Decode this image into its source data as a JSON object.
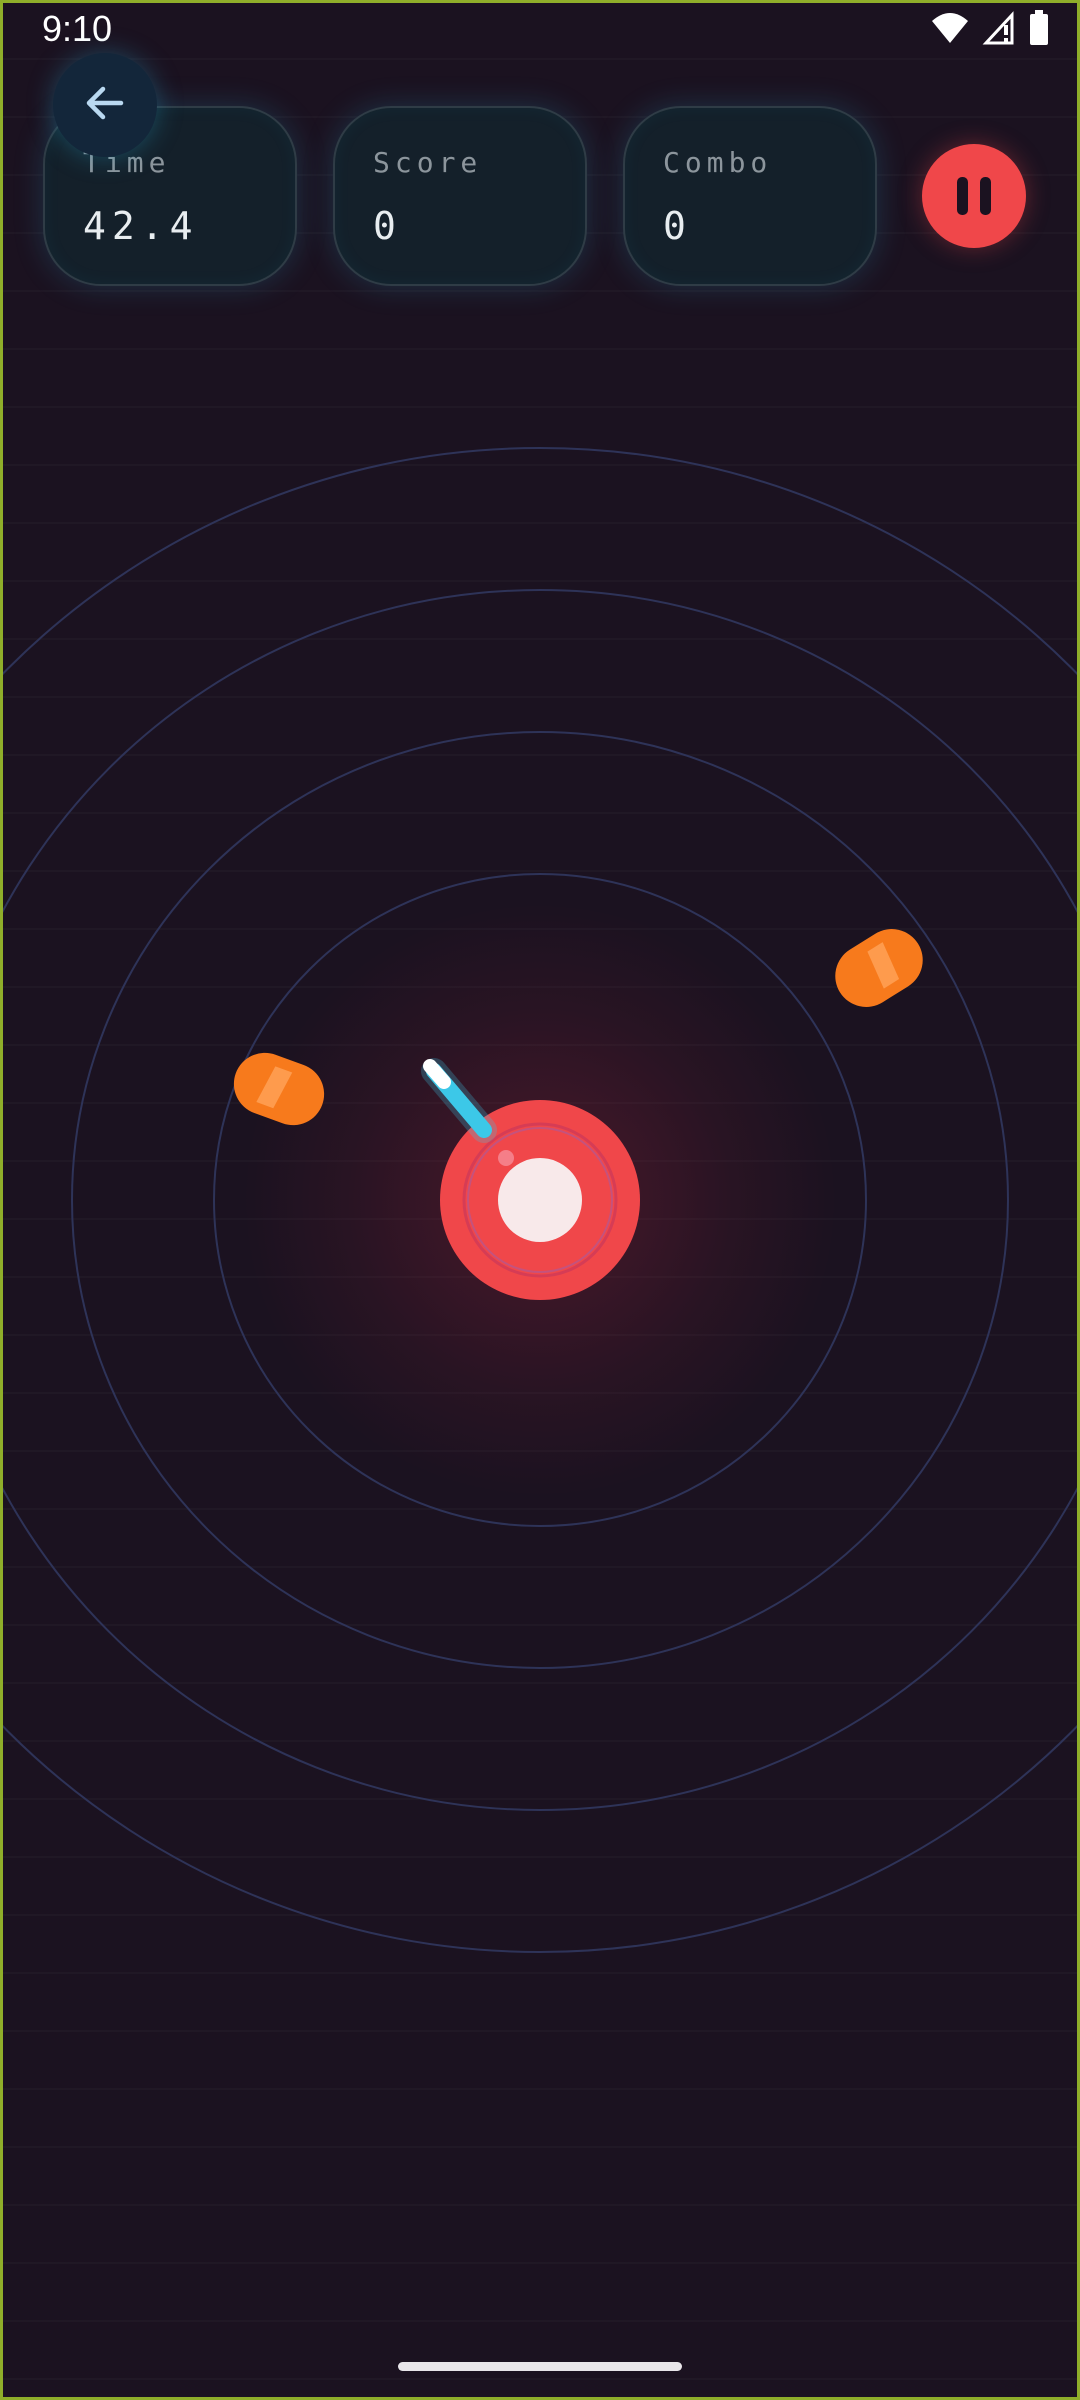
{
  "status_bar": {
    "time": "9:10",
    "icons": [
      "wifi-icon",
      "cell-signal-icon",
      "battery-icon"
    ]
  },
  "hud": {
    "time_label": "Time",
    "time_value": "42.4",
    "score_label": "Score",
    "score_value": "0",
    "combo_label": "Combo",
    "combo_value": "0"
  },
  "controls": {
    "back_icon": "arrow-left-icon",
    "pause_icon": "pause-icon"
  },
  "colors": {
    "background": "#1b1220",
    "player_core": "#f0474a",
    "player_center": "#f8e9ea",
    "blade": "#3cc8e8",
    "enemy": "#f77a1c",
    "hud_border": "#2f3c46",
    "ring": "#2e3358"
  }
}
